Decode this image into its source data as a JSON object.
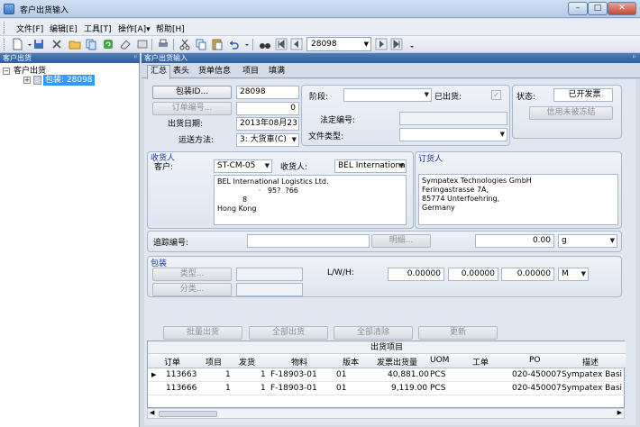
{
  "window": {
    "title": "客户出货输入",
    "min_label": "–",
    "max_label": "□",
    "close_label": "✕"
  },
  "menu": [
    "文件[F]",
    "编辑[E]",
    "工具[T]",
    "操作[A]▾",
    "帮助[H]"
  ],
  "toolbar": {
    "record_value": "28098"
  },
  "left_panel": {
    "title": "客户出货",
    "root_label": "客户出货",
    "child_label": "包装: 28098"
  },
  "right_panel": {
    "title": "客户出货输入"
  },
  "tabs": [
    "汇总",
    "表头",
    "货单信息",
    "项目",
    "填满"
  ],
  "summary": {
    "package_id_btn": "包装ID...",
    "package_id_value": "28098",
    "order_no_btn": "订单编号...",
    "order_no_value": "0",
    "ship_date_label": "出货日期:",
    "ship_date_value": "2013年08月23",
    "ship_method_label": "运送方法:",
    "ship_method_value": "3: 大货車(C)",
    "stage_label": "阶段:",
    "shipped_label": "已出货:",
    "legal_no_label": "法定编号:",
    "file_type_label": "文件类型:",
    "status_label": "状态:",
    "status_value": "已开发票",
    "credit_btn": "信用未被冻结"
  },
  "consignee": {
    "group_label": "收货人",
    "customer_label": "客户:",
    "customer_value": "ST-CM-05",
    "consignee_label": "收货人:",
    "consignee_value": "BEL Internationa",
    "address_lines": [
      "BEL International Logistics Ltd.",
      "                  ·   95?  ?66",
      "           8",
      "",
      "Hong Kong"
    ]
  },
  "order_party": {
    "group_label": "订货人",
    "address_lines": [
      "Sympatex Technologies GmbH",
      "Feringastrasse 7A,",
      "85774 Unterfoehring,",
      "Germany"
    ]
  },
  "tracking": {
    "label": "追踪编号:",
    "detail_btn": "明细...",
    "value": "0.00",
    "unit": "g"
  },
  "packing": {
    "group_label": "包装",
    "type_btn": "类型...",
    "class_btn": "分类...",
    "lwh_label": "L/W/H:",
    "l": "0.00000",
    "w": "0.00000",
    "h": "0.00000",
    "unit": "M"
  },
  "actions": {
    "batch": "批量出货",
    "all_ship": "全部出货",
    "all_clear": "全部清除",
    "update": "更新"
  },
  "grid": {
    "title": "出货项目",
    "columns": [
      "订单",
      "项目",
      "发货",
      "物料",
      "版本",
      "发票出货量",
      "UOM",
      "工单",
      "PO",
      "描述"
    ],
    "rows": [
      [
        "113663",
        "1",
        "1",
        "F-18903-01",
        "01",
        "40,881.00",
        "PCS",
        "",
        "020-450007",
        "Sympatex Basi"
      ],
      [
        "113666",
        "1",
        "1",
        "F-18903-01",
        "01",
        "9,119.00",
        "PCS",
        "",
        "020-450007",
        "Sympatex Basi"
      ]
    ]
  }
}
